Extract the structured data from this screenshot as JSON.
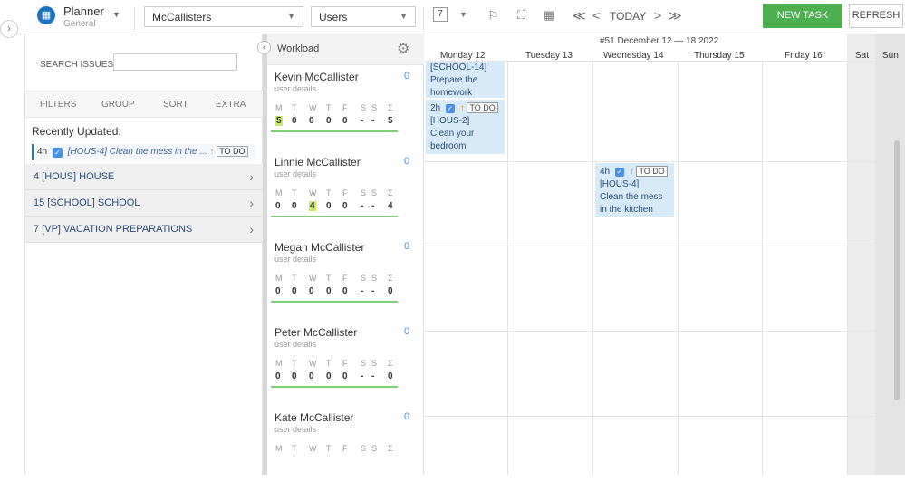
{
  "app": {
    "title": "Planner",
    "subtitle": "General",
    "icon": "calendar-icon"
  },
  "toolbar": {
    "project_select": "McCallisters",
    "users_select": "Users",
    "day_count": "7",
    "today_label": "TODAY",
    "prev_double": "≪",
    "prev": "<",
    "next": ">",
    "next_double": "≫",
    "new_task_label": "NEW TASK",
    "refresh_label": "REFRESH",
    "accent_color": "#4caf50"
  },
  "left_panel": {
    "search_label": "SEARCH ISSUES:",
    "search_value": "",
    "filters": [
      "FILTERS",
      "GROUP",
      "SORT",
      "EXTRA"
    ],
    "recent_label": "Recently Updated:",
    "recent_item": {
      "hours": "4h",
      "text": "[HOUS-4] Clean the mess in the ...",
      "status": "TO DO"
    },
    "groups": [
      "4 [HOUS] HOUSE",
      "15 [SCHOOL] SCHOOL",
      "7 [VP] VACATION PREPARATIONS"
    ]
  },
  "workload": {
    "title": "Workload",
    "day_letters": [
      "M",
      "T",
      "W",
      "T",
      "F",
      "S",
      "S",
      "Σ"
    ],
    "users": [
      {
        "name": "Kevin McCallister",
        "count": "0",
        "details": "user details",
        "values": [
          "5",
          "0",
          "0",
          "0",
          "0",
          "-",
          "-",
          "5"
        ],
        "highlight": 0
      },
      {
        "name": "Linnie McCallister",
        "count": "0",
        "details": "user details",
        "values": [
          "0",
          "0",
          "4",
          "0",
          "0",
          "-",
          "-",
          "4"
        ],
        "highlight": 2
      },
      {
        "name": "Megan McCallister",
        "count": "0",
        "details": "user details",
        "values": [
          "0",
          "0",
          "0",
          "0",
          "0",
          "-",
          "-",
          "0"
        ],
        "highlight": -1
      },
      {
        "name": "Peter McCallister",
        "count": "0",
        "details": "user details",
        "values": [
          "0",
          "0",
          "0",
          "0",
          "0",
          "-",
          "-",
          "0"
        ],
        "highlight": -1
      },
      {
        "name": "Kate McCallister",
        "count": "0",
        "details": "user details",
        "values": [],
        "highlight": -1
      }
    ]
  },
  "calendar": {
    "range": "#51 December 12 — 18 2022",
    "days": [
      "Monday 12",
      "Tuesday 13",
      "Wednesday 14",
      "Thursday 15",
      "Friday 16",
      "Sat",
      "Sun"
    ],
    "tasks": [
      {
        "lines": [
          "[SCHOOL-14]",
          "Prepare the",
          "homework"
        ]
      },
      {
        "hours": "2h",
        "status": "TO DO",
        "lines": [
          "[HOUS-2]",
          "Clean your",
          "bedroom"
        ]
      },
      {
        "hours": "4h",
        "status": "TO DO",
        "lines": [
          "[HOUS-4]",
          "Clean the mess",
          "in the kitchen"
        ]
      }
    ]
  }
}
